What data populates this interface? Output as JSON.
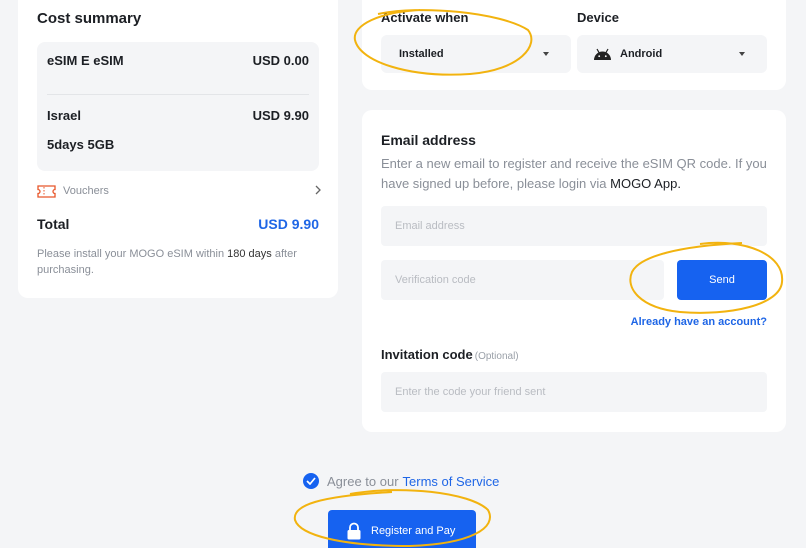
{
  "cost_summary": {
    "title": "Cost summary",
    "items": [
      {
        "label": "eSIM E eSIM",
        "value": "USD 0.00"
      },
      {
        "label": "Israel",
        "value": "USD 9.90"
      },
      {
        "label": "5days 5GB"
      }
    ],
    "vouchers_label": "Vouchers",
    "total_label": "Total",
    "total_value": "USD 9.90",
    "note_before": "Please install your MOGO eSIM within",
    "note_days": "180 days",
    "note_after": "after purchasing."
  },
  "activation": {
    "activate_label": "Activate when",
    "activate_value": "Installed",
    "device_label": "Device",
    "device_value": "Android",
    "device_icon": "android-icon"
  },
  "email": {
    "title": "Email address",
    "description": "Enter a new email to register and receive the eSIM QR code. If you have signed up before, please login via",
    "app_name": "MOGO App",
    "email_placeholder": "Email address",
    "code_placeholder": "Verification code",
    "send_label": "Send",
    "account_link": "Already have an account?",
    "invite_label": "Invitation code",
    "invite_optional": "(Optional)",
    "invite_placeholder": "Enter the code your friend sent"
  },
  "footer": {
    "agree_text": "Agree to our",
    "terms_link": "Terms of Service",
    "pay_label": "Register and Pay"
  },
  "colors": {
    "accent": "#1662f0",
    "annotation": "#f2b30f"
  }
}
